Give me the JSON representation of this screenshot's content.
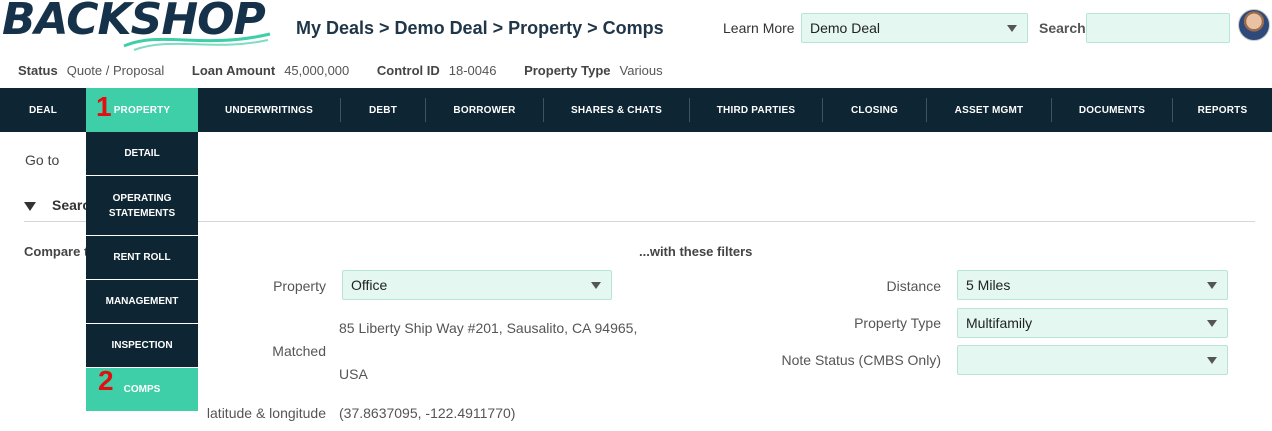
{
  "header": {
    "logo_text": "BACKSHOP",
    "breadcrumb": "My Deals > Demo Deal > Property > Comps",
    "learn_more": "Learn More",
    "deal_select_value": "Demo Deal",
    "search_label": "Search",
    "search_placeholder": ""
  },
  "status_bar": [
    {
      "key": "Status",
      "value": "Quote / Proposal"
    },
    {
      "key": "Loan Amount",
      "value": "45,000,000"
    },
    {
      "key": "Control ID",
      "value": "18-0046"
    },
    {
      "key": "Property Type",
      "value": "Various"
    }
  ],
  "nav": {
    "items": [
      "DEAL",
      "PROPERTY",
      "UNDERWRITINGS",
      "DEBT",
      "BORROWER",
      "SHARES & CHATS",
      "THIRD PARTIES",
      "CLOSING",
      "ASSET MGMT",
      "DOCUMENTS",
      "REPORTS"
    ],
    "active": "PROPERTY"
  },
  "property_menu": {
    "items": [
      "DETAIL",
      "OPERATING STATEMENTS",
      "RENT ROLL",
      "MANAGEMENT",
      "INSPECTION",
      "COMPS"
    ],
    "active": "COMPS"
  },
  "annotations": {
    "step1": "1",
    "step2": "2"
  },
  "main": {
    "goto_label": "Go to",
    "search_section": "Search",
    "compare_label": "Compare t",
    "filters_heading": "...with these filters",
    "property_label": "Property",
    "property_value": "Office",
    "matched_label": "Matched",
    "matched_line1": "85 Liberty Ship Way #201, Sausalito, CA 94965,",
    "matched_line2": "USA",
    "latlng_label": "latitude & longitude",
    "latlng_value": "(37.8637095, -122.4911770)",
    "distance_label": "Distance",
    "distance_value": "5 Miles",
    "ptype_label": "Property Type",
    "ptype_value": "Multifamily",
    "note_label": "Note Status (CMBS Only)",
    "note_value": ""
  },
  "colors": {
    "nav_bg": "#0e2634",
    "accent": "#3ecfa8",
    "field_bg": "#e4f7f1",
    "annotation": "#e10f0f"
  }
}
